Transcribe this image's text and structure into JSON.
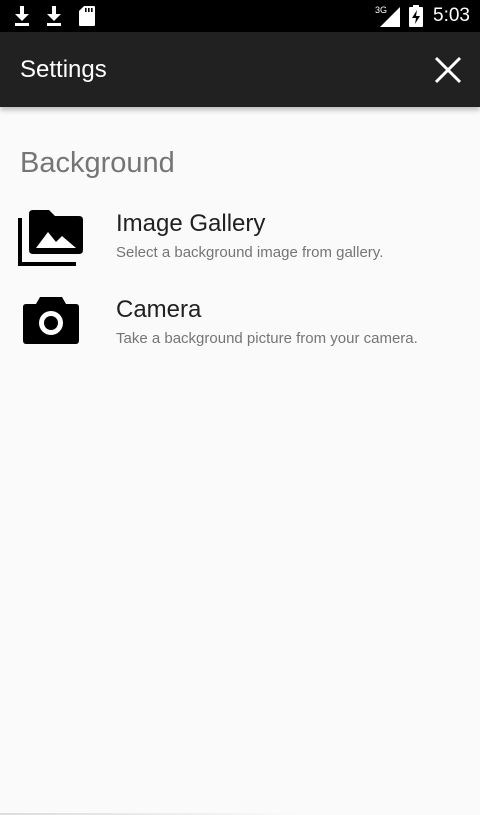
{
  "status_bar": {
    "network": "3G",
    "time": "5:03",
    "icons": [
      "download-icon",
      "download-icon",
      "sd-card-icon",
      "signal-3g-icon",
      "battery-charging-icon"
    ]
  },
  "app_bar": {
    "title": "Settings",
    "close_icon": "close-icon"
  },
  "section": {
    "title": "Background"
  },
  "items": [
    {
      "title": "Image Gallery",
      "summary": "Select a background image from gallery.",
      "icon": "photo-library-icon"
    },
    {
      "title": "Camera",
      "summary": "Take a background picture from your camera.",
      "icon": "camera-icon"
    }
  ],
  "colors": {
    "status_bar": "#000000",
    "app_bar": "#212121",
    "background": "#fafafa",
    "primary_text": "#212121",
    "secondary_text": "#757575"
  }
}
